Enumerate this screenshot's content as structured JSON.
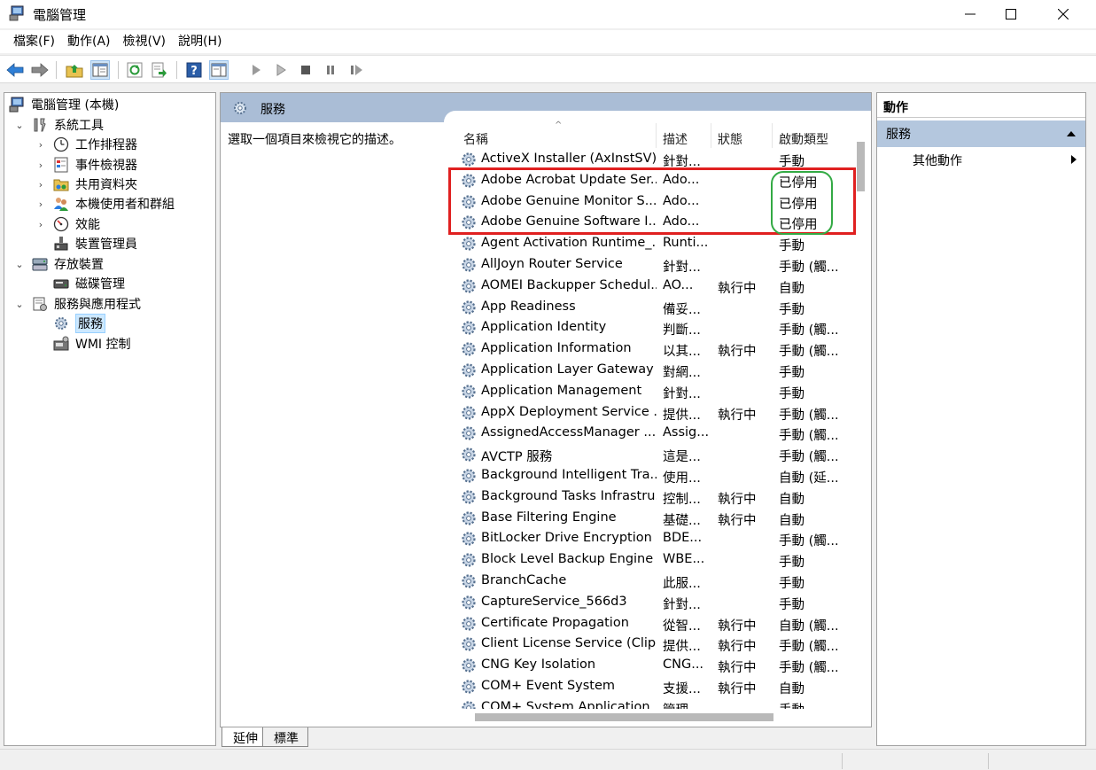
{
  "window": {
    "title": "電腦管理",
    "controls": [
      "minimize-icon",
      "maximize-icon",
      "close-icon"
    ]
  },
  "menu": [
    "檔案(F)",
    "動作(A)",
    "檢視(V)",
    "說明(H)"
  ],
  "toolbar": [
    "back-arrow-icon",
    "forward-arrow-icon",
    "up-folder-icon",
    "show-hide-tree-icon",
    "refresh-icon",
    "export-list-icon",
    "help-icon",
    "properties-pane-icon",
    "play-icon",
    "play-outline-icon",
    "stop-icon",
    "pause-icon",
    "restart-icon"
  ],
  "tree": [
    {
      "label": "電腦管理 (本機)",
      "icon": "computer-management-icon"
    },
    {
      "label": "系統工具",
      "icon": "tools-icon",
      "toggle": "⌄"
    },
    {
      "label": "工作排程器",
      "icon": "clock-icon",
      "toggle": "›"
    },
    {
      "label": "事件檢視器",
      "icon": "event-viewer-icon",
      "toggle": "›"
    },
    {
      "label": "共用資料夾",
      "icon": "shared-folder-icon",
      "toggle": "›"
    },
    {
      "label": "本機使用者和群組",
      "icon": "users-icon",
      "toggle": "›"
    },
    {
      "label": "效能",
      "icon": "performance-icon",
      "toggle": "›"
    },
    {
      "label": "裝置管理員",
      "icon": "device-manager-icon"
    },
    {
      "label": "存放裝置",
      "icon": "storage-icon",
      "toggle": "⌄"
    },
    {
      "label": "磁碟管理",
      "icon": "disk-icon"
    },
    {
      "label": "服務與應用程式",
      "icon": "services-apps-icon",
      "toggle": "⌄"
    },
    {
      "label": "服務",
      "icon": "services-gear-icon",
      "selected": true
    },
    {
      "label": "WMI 控制",
      "icon": "wmi-icon"
    }
  ],
  "center": {
    "header": "服務",
    "description": "選取一個項目來檢視它的描述。",
    "columns": {
      "name": "名稱",
      "desc": "描述",
      "status": "狀態",
      "start": "啟動類型"
    },
    "services": [
      {
        "name": "ActiveX Installer (AxInstSV)",
        "desc": "針對...",
        "status": "",
        "start": "手動"
      },
      {
        "name": "Adobe Acrobat Update Ser...",
        "desc": "Ado...",
        "status": "",
        "start": "已停用"
      },
      {
        "name": "Adobe Genuine Monitor S...",
        "desc": "Ado...",
        "status": "",
        "start": "已停用"
      },
      {
        "name": "Adobe Genuine Software I...",
        "desc": "Ado...",
        "status": "",
        "start": "已停用"
      },
      {
        "name": "Agent Activation Runtime_...",
        "desc": "Runti...",
        "status": "",
        "start": "手動"
      },
      {
        "name": "AllJoyn Router Service",
        "desc": "針對...",
        "status": "",
        "start": "手動 (觸..."
      },
      {
        "name": "AOMEI Backupper Schedul...",
        "desc": "AO...",
        "status": "執行中",
        "start": "自動"
      },
      {
        "name": "App Readiness",
        "desc": "備妥...",
        "status": "",
        "start": "手動"
      },
      {
        "name": "Application Identity",
        "desc": "判斷...",
        "status": "",
        "start": "手動 (觸..."
      },
      {
        "name": "Application Information",
        "desc": "以其...",
        "status": "執行中",
        "start": "手動 (觸..."
      },
      {
        "name": "Application Layer Gateway ...",
        "desc": "對網...",
        "status": "",
        "start": "手動"
      },
      {
        "name": "Application Management",
        "desc": "針對...",
        "status": "",
        "start": "手動"
      },
      {
        "name": "AppX Deployment Service ...",
        "desc": "提供...",
        "status": "執行中",
        "start": "手動 (觸..."
      },
      {
        "name": "AssignedAccessManager ...",
        "desc": "Assig...",
        "status": "",
        "start": "手動 (觸..."
      },
      {
        "name": "AVCTP 服務",
        "desc": "這是...",
        "status": "",
        "start": "手動 (觸..."
      },
      {
        "name": "Background Intelligent Tra...",
        "desc": "使用...",
        "status": "",
        "start": "自動 (延..."
      },
      {
        "name": "Background Tasks Infrastru...",
        "desc": "控制...",
        "status": "執行中",
        "start": "自動"
      },
      {
        "name": "Base Filtering Engine",
        "desc": "基礎...",
        "status": "執行中",
        "start": "自動"
      },
      {
        "name": "BitLocker Drive Encryption ...",
        "desc": "BDE...",
        "status": "",
        "start": "手動 (觸..."
      },
      {
        "name": "Block Level Backup Engine ...",
        "desc": "WBE...",
        "status": "",
        "start": "手動"
      },
      {
        "name": "BranchCache",
        "desc": "此服...",
        "status": "",
        "start": "手動"
      },
      {
        "name": "CaptureService_566d3",
        "desc": "針對...",
        "status": "",
        "start": "手動"
      },
      {
        "name": "Certificate Propagation",
        "desc": "從智...",
        "status": "執行中",
        "start": "自動 (觸..."
      },
      {
        "name": "Client License Service (Clip...",
        "desc": "提供...",
        "status": "執行中",
        "start": "手動 (觸..."
      },
      {
        "name": "CNG Key Isolation",
        "desc": "CNG...",
        "status": "執行中",
        "start": "手動 (觸..."
      },
      {
        "name": "COM+ Event System",
        "desc": "支援...",
        "status": "執行中",
        "start": "自動"
      },
      {
        "name": "COM+ System Application",
        "desc": "管理...",
        "status": "",
        "start": "手動"
      }
    ]
  },
  "bottom_tabs": [
    "延伸",
    "標準"
  ],
  "actions": {
    "title": "動作",
    "section": "服務",
    "item": "其他動作"
  },
  "colors": {
    "highlight_red": "#e02020",
    "highlight_green": "#33aa44",
    "header_blue": "#aabdd6",
    "selection": "#cce8ff"
  }
}
